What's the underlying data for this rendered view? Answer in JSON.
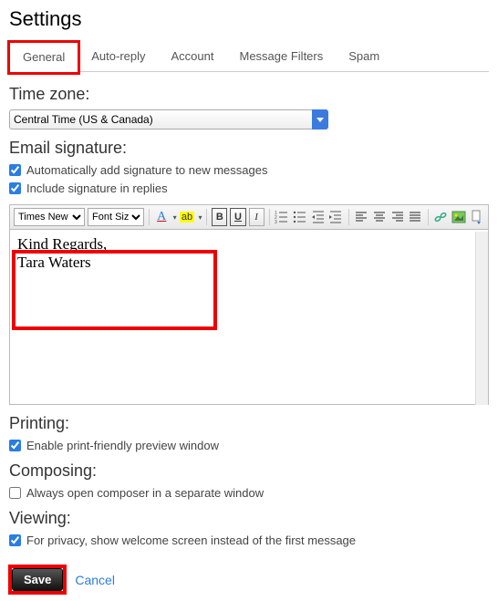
{
  "page_title": "Settings",
  "tabs": {
    "general": "General",
    "autoreply": "Auto-reply",
    "account": "Account",
    "filters": "Message Filters",
    "spam": "Spam"
  },
  "sections": {
    "timezone_label": "Time zone:",
    "signature_label": "Email signature:",
    "printing_label": "Printing:",
    "composing_label": "Composing:",
    "viewing_label": "Viewing:"
  },
  "timezone": {
    "selected": "Central Time (US & Canada)"
  },
  "signature": {
    "auto_add_label": "Automatically add signature to new messages",
    "include_replies_label": "Include signature in replies",
    "content_line1": "Kind Regards,",
    "content_line2": "Tara Waters"
  },
  "editor_toolbar": {
    "font_name": "Times New R",
    "font_size_label": "Font Size",
    "text_color_label": "A",
    "highlight_label": "ab",
    "bold": "B",
    "underline": "U",
    "italic": "I"
  },
  "printing": {
    "enable_label": "Enable print-friendly preview window"
  },
  "composing": {
    "separate_window_label": "Always open composer in a separate window"
  },
  "viewing": {
    "privacy_label": "For privacy, show welcome screen instead of the first message"
  },
  "buttons": {
    "save": "Save",
    "cancel": "Cancel"
  }
}
